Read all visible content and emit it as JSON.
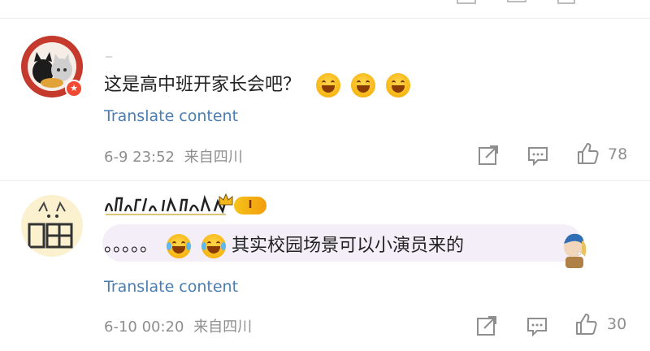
{
  "top": {},
  "comments": [
    {
      "username": "",
      "text": "这是高中班开家长会吧？",
      "emojis": [
        "laughing-emoji",
        "laughing-emoji",
        "laughing-emoji"
      ],
      "translate": "Translate content",
      "timestamp": "6-9 23:52",
      "location": "来自四川",
      "likes": "78"
    },
    {
      "username": "",
      "level": "I",
      "dots": "。。。。。",
      "text": "其实校园场景可以小演员来的",
      "emojis": [
        "crying-laughing-emoji",
        "crying-laughing-emoji"
      ],
      "translate": "Translate content",
      "timestamp": "6-10 00:20",
      "location": "来自四川",
      "likes": "30"
    }
  ],
  "colors": {
    "link": "#4b7cb1",
    "meta": "#8e8e8e",
    "badge": "#f04a35",
    "level": "#f7c21a"
  },
  "icons": [
    "share-icon",
    "comment-icon",
    "like-icon"
  ]
}
